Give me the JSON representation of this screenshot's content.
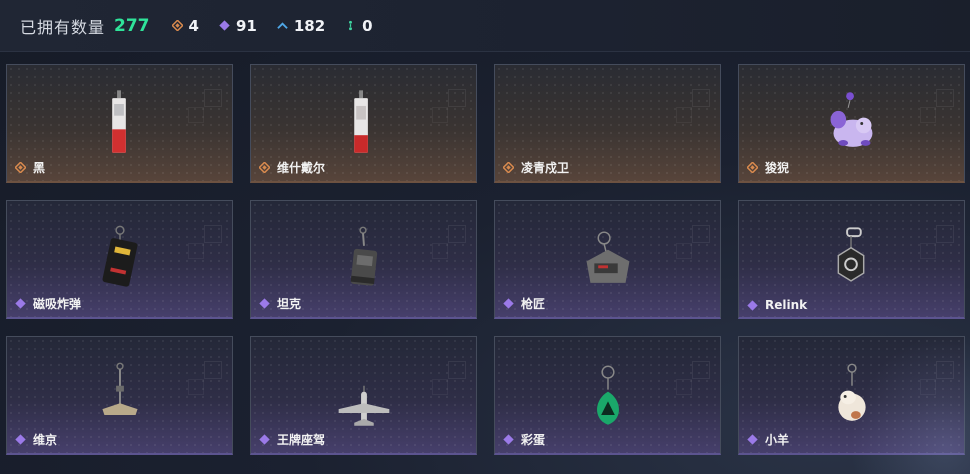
{
  "header": {
    "owned_label": "已拥有数量",
    "owned_count": "277",
    "stats": [
      {
        "icon": "orange-diamond-icon",
        "value": "4",
        "color": "#d98a4e"
      },
      {
        "icon": "purple-diamond-icon",
        "value": "91",
        "color": "#9b7ae8"
      },
      {
        "icon": "blue-chevron-icon",
        "value": "182",
        "color": "#4fa8e8"
      },
      {
        "icon": "green-dots-icon",
        "value": "0",
        "color": "#3fd6a2"
      }
    ]
  },
  "items": [
    {
      "name": "黑",
      "rarity": "orange",
      "charm": "red-white-tag"
    },
    {
      "name": "维什戴尔",
      "rarity": "orange",
      "charm": "red-white-tag"
    },
    {
      "name": "凌青戍卫",
      "rarity": "orange",
      "charm": "none"
    },
    {
      "name": "狻猊",
      "rarity": "orange",
      "charm": "purple-creature"
    },
    {
      "name": "磁吸炸弹",
      "rarity": "purple",
      "charm": "bomb"
    },
    {
      "name": "坦克",
      "rarity": "purple",
      "charm": "tank"
    },
    {
      "name": "枪匠",
      "rarity": "purple",
      "charm": "toolbox"
    },
    {
      "name": "Relink",
      "rarity": "purple",
      "charm": "relink-emblem"
    },
    {
      "name": "维京",
      "rarity": "purple",
      "charm": "viking-axe"
    },
    {
      "name": "王牌座驾",
      "rarity": "purple",
      "charm": "jet-plane"
    },
    {
      "name": "彩蛋",
      "rarity": "purple",
      "charm": "green-egg"
    },
    {
      "name": "小羊",
      "rarity": "purple",
      "charm": "lamb"
    }
  ]
}
